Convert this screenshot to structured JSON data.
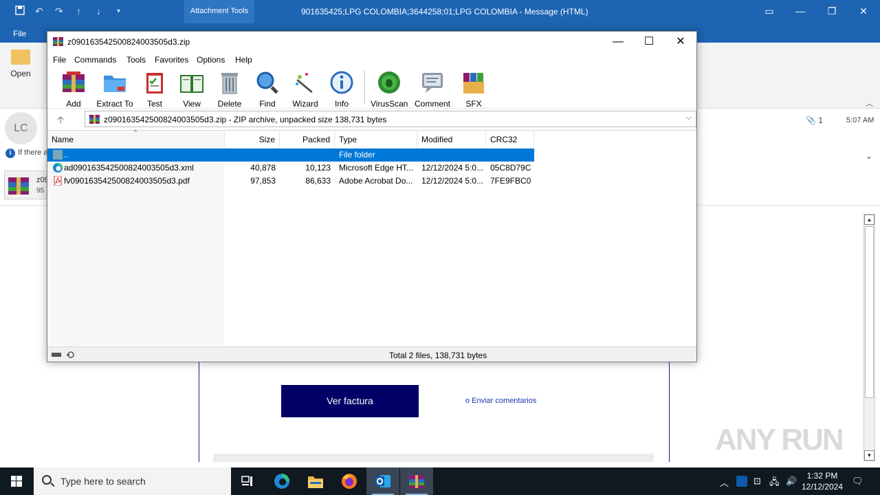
{
  "outlook": {
    "title_bar": {
      "contextual_tab": "Attachment Tools",
      "window_title": "901635425;LPG  COLOMBIA;3644258;01;LPG  COLOMBIA  -  Message (HTML)"
    },
    "tabs": {
      "file": "File"
    },
    "ribbon": {
      "open_label": "Open"
    },
    "sender": {
      "initials": "LC"
    },
    "info_bar": "If there a",
    "attachment_count": "1",
    "time": "5:07 AM",
    "attachment": {
      "name": "z09",
      "size": "95"
    }
  },
  "email": {
    "ver_factura": "Ver factura",
    "enviar": "o Enviar comentarios"
  },
  "watermark": "ANY RUN",
  "winrar": {
    "title": "z09016354250082400350 5d3.zip",
    "menu": [
      "File",
      "Commands",
      "Tools",
      "Favorites",
      "Options",
      "Help"
    ],
    "toolbar": [
      "Add",
      "Extract To",
      "Test",
      "View",
      "Delete",
      "Find",
      "Wizard",
      "Info",
      "VirusScan",
      "Comment",
      "SFX"
    ],
    "address": "z090163542500824003505d3.zip - ZIP archive, unpacked size 138,731 bytes",
    "columns": [
      "Name",
      "Size",
      "Packed",
      "Type",
      "Modified",
      "CRC32"
    ],
    "rows": [
      {
        "name": "..",
        "size": "",
        "packed": "",
        "type": "File folder",
        "modified": "",
        "crc": ""
      },
      {
        "name": "ad090163542500824003505d3.xml",
        "size": "40,878",
        "packed": "10,123",
        "type": "Microsoft Edge HT...",
        "modified": "12/12/2024 5:0...",
        "crc": "05C8D79C"
      },
      {
        "name": "fv090163542500824003505d3.pdf",
        "size": "97,853",
        "packed": "86,633",
        "type": "Adobe Acrobat Do...",
        "modified": "12/12/2024 5:0...",
        "crc": "7FE9FBC0"
      }
    ],
    "status": "Total 2 files, 138,731 bytes"
  },
  "taskbar": {
    "search_placeholder": "Type here to search",
    "time": "1:32 PM",
    "date": "12/12/2024"
  }
}
